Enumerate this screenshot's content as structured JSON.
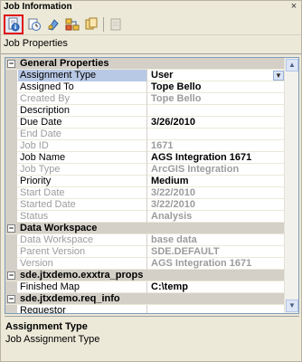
{
  "window": {
    "title": "Job Information",
    "close_glyph": "×"
  },
  "toolbar": {
    "buttons": [
      {
        "name": "job-properties-icon",
        "active": true
      },
      {
        "name": "job-history-icon",
        "active": false
      },
      {
        "name": "hold-icon",
        "active": false
      },
      {
        "name": "job-map-icon",
        "active": false
      },
      {
        "name": "attachments-icon",
        "active": false
      },
      {
        "name": "extended-properties-icon",
        "active": false
      }
    ]
  },
  "panel": {
    "title": "Job Properties"
  },
  "grid": {
    "categories": [
      {
        "label": "General Properties",
        "rows": [
          {
            "label": "Assignment Type",
            "value": "User",
            "readonly": false,
            "selected": true,
            "dropdown": true
          },
          {
            "label": "Assigned To",
            "value": "Tope Bello",
            "readonly": false
          },
          {
            "label": "Created By",
            "value": "Tope Bello",
            "readonly": true
          },
          {
            "label": "Description",
            "value": "",
            "readonly": false
          },
          {
            "label": "Due Date",
            "value": "3/26/2010",
            "readonly": false
          },
          {
            "label": "End Date",
            "value": "",
            "readonly": true
          },
          {
            "label": "Job ID",
            "value": "1671",
            "readonly": true
          },
          {
            "label": "Job Name",
            "value": "AGS Integration 1671",
            "readonly": false
          },
          {
            "label": "Job Type",
            "value": "ArcGIS Integration",
            "readonly": true
          },
          {
            "label": "Priority",
            "value": "Medium",
            "readonly": false
          },
          {
            "label": "Start Date",
            "value": "3/22/2010",
            "readonly": true
          },
          {
            "label": "Started Date",
            "value": "3/22/2010",
            "readonly": true
          },
          {
            "label": "Status",
            "value": "Analysis",
            "readonly": true
          }
        ]
      },
      {
        "label": "Data Workspace",
        "rows": [
          {
            "label": "Data Workspace",
            "value": "base data",
            "readonly": true
          },
          {
            "label": "Parent Version",
            "value": "SDE.DEFAULT",
            "readonly": true
          },
          {
            "label": "Version",
            "value": "AGS Integration 1671",
            "readonly": true
          }
        ]
      },
      {
        "label": "sde.jtxdemo.exxtra_props",
        "rows": [
          {
            "label": "Finished Map",
            "value": "C:\\temp",
            "readonly": false
          }
        ]
      },
      {
        "label": "sde.jtxdemo.req_info",
        "rows": [
          {
            "label": "Requestor",
            "value": "",
            "readonly": false
          }
        ]
      }
    ]
  },
  "description": {
    "title": "Assignment Type",
    "text": "Job Assignment Type"
  },
  "colors": {
    "selected_row": "#b8c9e6",
    "active_tool_border": "#e01010",
    "category_bg": "#d4d0c8"
  }
}
